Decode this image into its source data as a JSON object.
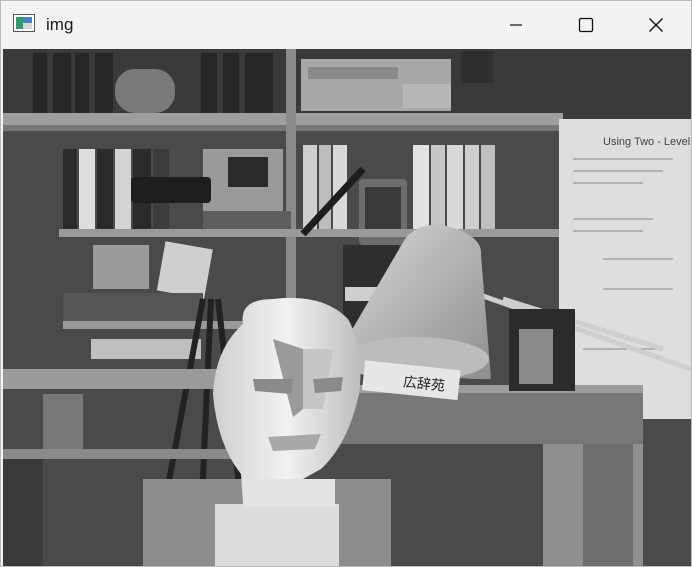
{
  "window": {
    "title": "img",
    "controls": {
      "minimize_icon": "minimize-icon",
      "maximize_icon": "maximize-icon",
      "close_icon": "close-icon"
    }
  },
  "image": {
    "content": "grayscale photo of a cluttered lab bench",
    "book_spine_text": "広辞苑",
    "poster_text": "Using Two - Level Dyna"
  }
}
